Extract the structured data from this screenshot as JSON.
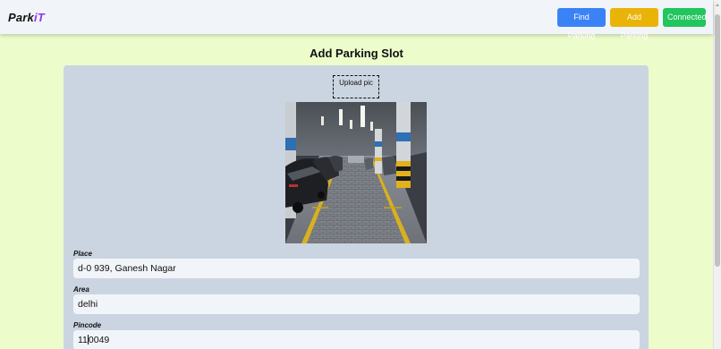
{
  "navbar": {
    "logo_part1": "Park",
    "logo_part2": "iT",
    "buttons": {
      "find_parking": "Find Parking",
      "add_parking": "Add Parking",
      "connected": "Connected"
    }
  },
  "page": {
    "title": "Add Parking Slot"
  },
  "form": {
    "upload_label": "Upload pic",
    "fields": {
      "place": {
        "label": "Place",
        "value": "d-0 939, Ganesh Nagar"
      },
      "area": {
        "label": "Area",
        "value": "delhi"
      },
      "pincode": {
        "label": "Pincode",
        "value_before_caret": "11",
        "value_after_caret": "0049"
      }
    }
  },
  "colors": {
    "page_bg": "#ecfccb",
    "card_bg": "#cbd5e1",
    "find_button": "#3b82f6",
    "add_button": "#eab308",
    "connected_button": "#22c55e",
    "logo_accent": "#9333ea"
  }
}
